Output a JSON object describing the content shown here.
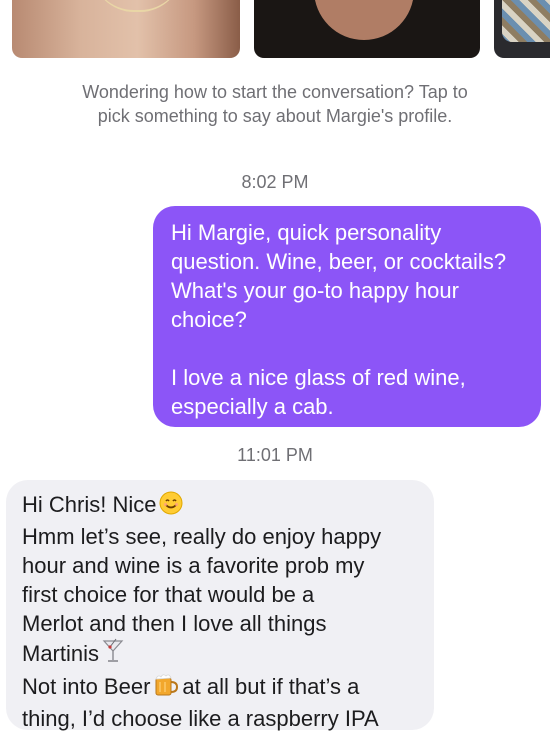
{
  "hint": {
    "line1": "Wondering how to start the conversation? Tap to",
    "line2": "pick something to say about Margie's profile."
  },
  "timestamps": [
    "8:02 PM",
    "11:01 PM"
  ],
  "outgoing": {
    "paragraph1": "Hi Margie, quick personality question. Wine, beer, or cocktails? What's your go-to happy hour choice?",
    "paragraph2": "I love a nice glass of red wine, especially a cab."
  },
  "incoming": {
    "line1": "Hi Chris! Nice",
    "line2": "Hmm let’s see, really do enjoy happy",
    "line3": "hour and wine is a favorite prob my",
    "line4": "first choice for that would be a",
    "line5": "Merlot and then I love all things",
    "line6": "Martinis",
    "line7a": "Not into Beer",
    "line7b": "at all but if that’s a",
    "line8": "thing, I’d choose like a raspberry IPA"
  },
  "icons": {
    "smile": "smiling-face-icon",
    "martini": "cocktail-glass-icon",
    "beer": "beer-mug-icon"
  },
  "colors": {
    "outgoing_bubble": "#8c55f7",
    "incoming_bubble": "#f0f0f4",
    "meta_text": "#6f6f74"
  }
}
